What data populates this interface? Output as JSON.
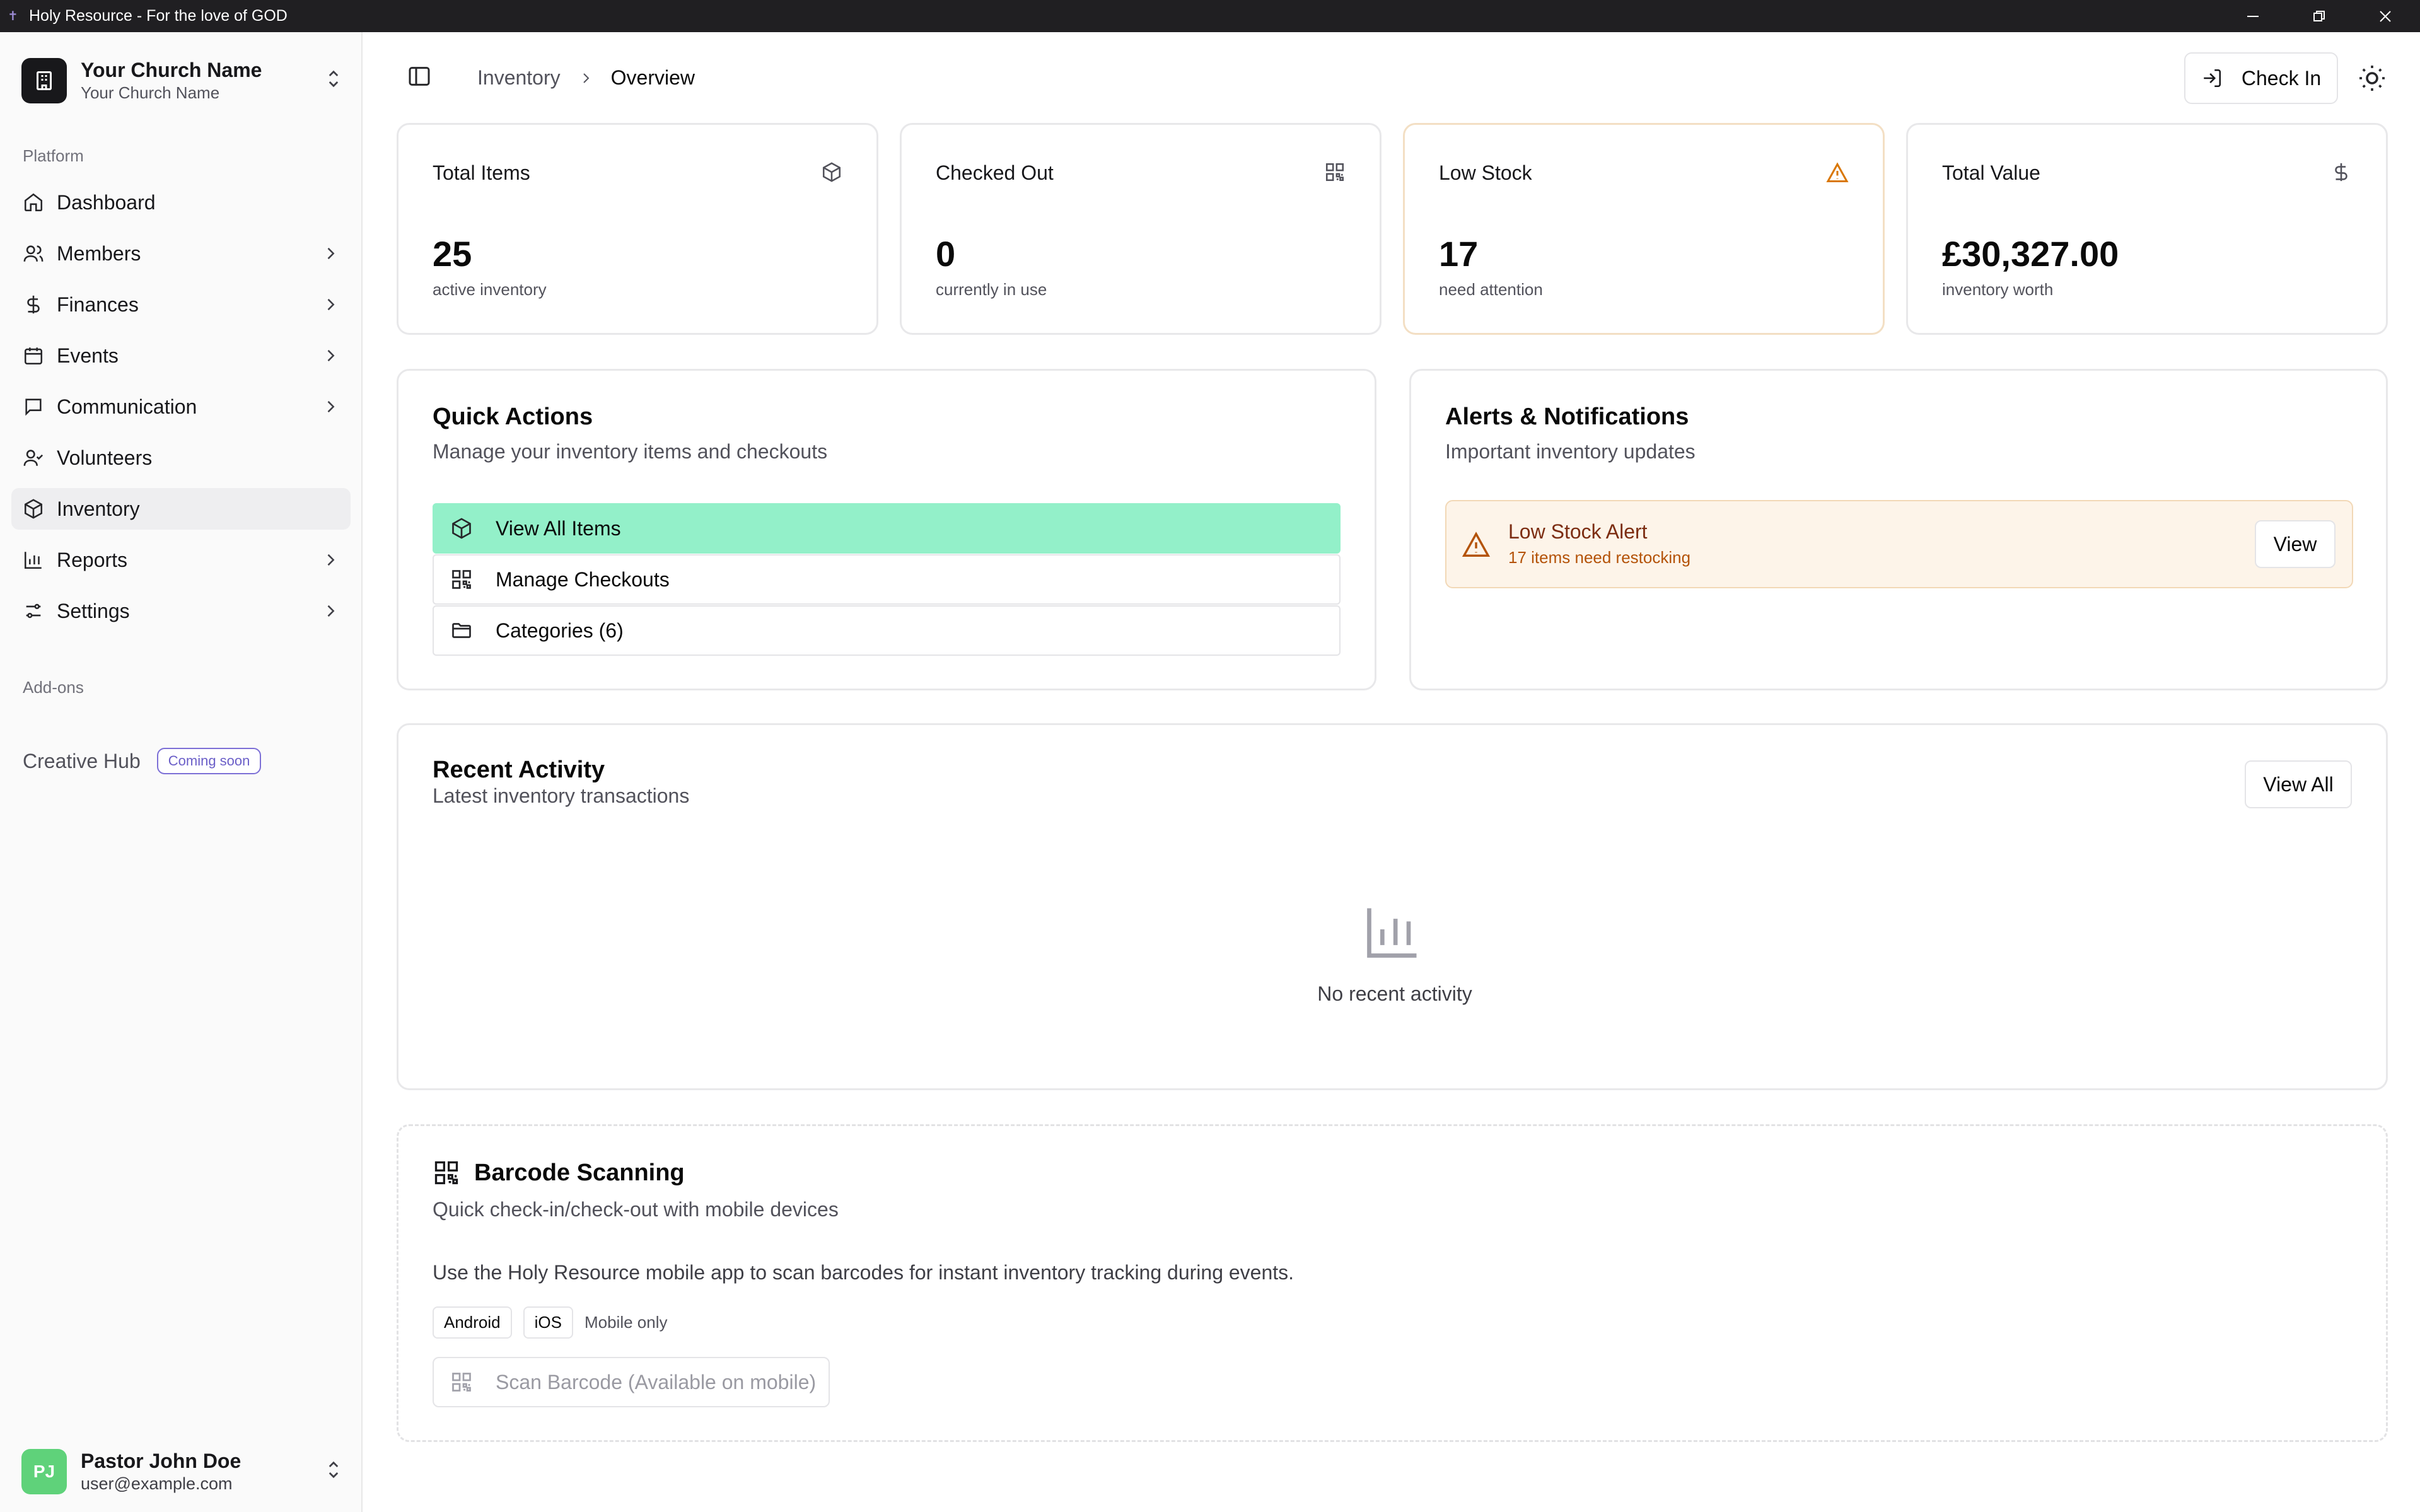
{
  "window": {
    "title": "Holy Resource - For the love of GOD"
  },
  "org": {
    "name": "Your Church Name",
    "subtitle": "Your Church Name"
  },
  "sidebar": {
    "section_platform": "Platform",
    "items": [
      {
        "label": "Dashboard",
        "icon": "home-icon"
      },
      {
        "label": "Members",
        "icon": "users-icon"
      },
      {
        "label": "Finances",
        "icon": "dollar-icon"
      },
      {
        "label": "Events",
        "icon": "calendar-icon"
      },
      {
        "label": "Communication",
        "icon": "message-icon"
      },
      {
        "label": "Volunteers",
        "icon": "volunteer-icon"
      },
      {
        "label": "Inventory",
        "icon": "package-icon",
        "active": true
      },
      {
        "label": "Reports",
        "icon": "bar-chart-icon"
      },
      {
        "label": "Settings",
        "icon": "sliders-icon"
      }
    ],
    "section_addons": "Add-ons",
    "addon": {
      "label": "Creative Hub",
      "badge": "Coming soon"
    }
  },
  "user": {
    "initials": "PJ",
    "name": "Pastor John Doe",
    "email": "user@example.com"
  },
  "header": {
    "breadcrumb": [
      "Inventory",
      "Overview"
    ],
    "checkin_label": "Check In"
  },
  "stats": [
    {
      "title": "Total Items",
      "value": "25",
      "sub": "active inventory",
      "icon": "package-icon"
    },
    {
      "title": "Checked Out",
      "value": "0",
      "sub": "currently in use",
      "icon": "qr-code-icon"
    },
    {
      "title": "Low Stock",
      "value": "17",
      "sub": "need attention",
      "icon": "alert-triangle-icon",
      "accent": "#d97706"
    },
    {
      "title": "Total Value",
      "value": "£30,327.00",
      "sub": "inventory worth",
      "icon": "dollar-icon"
    }
  ],
  "quick_actions": {
    "title": "Quick Actions",
    "description": "Manage your inventory items and checkouts",
    "items": [
      {
        "label": "View All Items",
        "icon": "package-icon"
      },
      {
        "label": "Manage Checkouts",
        "icon": "qr-code-icon"
      },
      {
        "label": "Categories (6)",
        "icon": "folder-icon"
      }
    ],
    "primary_color": "#93f0c9"
  },
  "alerts": {
    "title": "Alerts & Notifications",
    "description": "Important inventory updates",
    "alert": {
      "heading": "Low Stock Alert",
      "detail": "17 items need restocking",
      "button": "View"
    }
  },
  "recent_activity": {
    "title": "Recent Activity",
    "description": "Latest inventory transactions",
    "view_all": "View All",
    "empty_text": "No recent activity"
  },
  "barcode": {
    "title": "Barcode Scanning",
    "description": "Quick check-in/check-out with mobile devices",
    "body": "Use the Holy Resource mobile app to scan barcodes for instant inventory tracking during events.",
    "tags": [
      "Android",
      "iOS"
    ],
    "note": "Mobile only",
    "scan_button": "Scan Barcode (Available on mobile)"
  }
}
